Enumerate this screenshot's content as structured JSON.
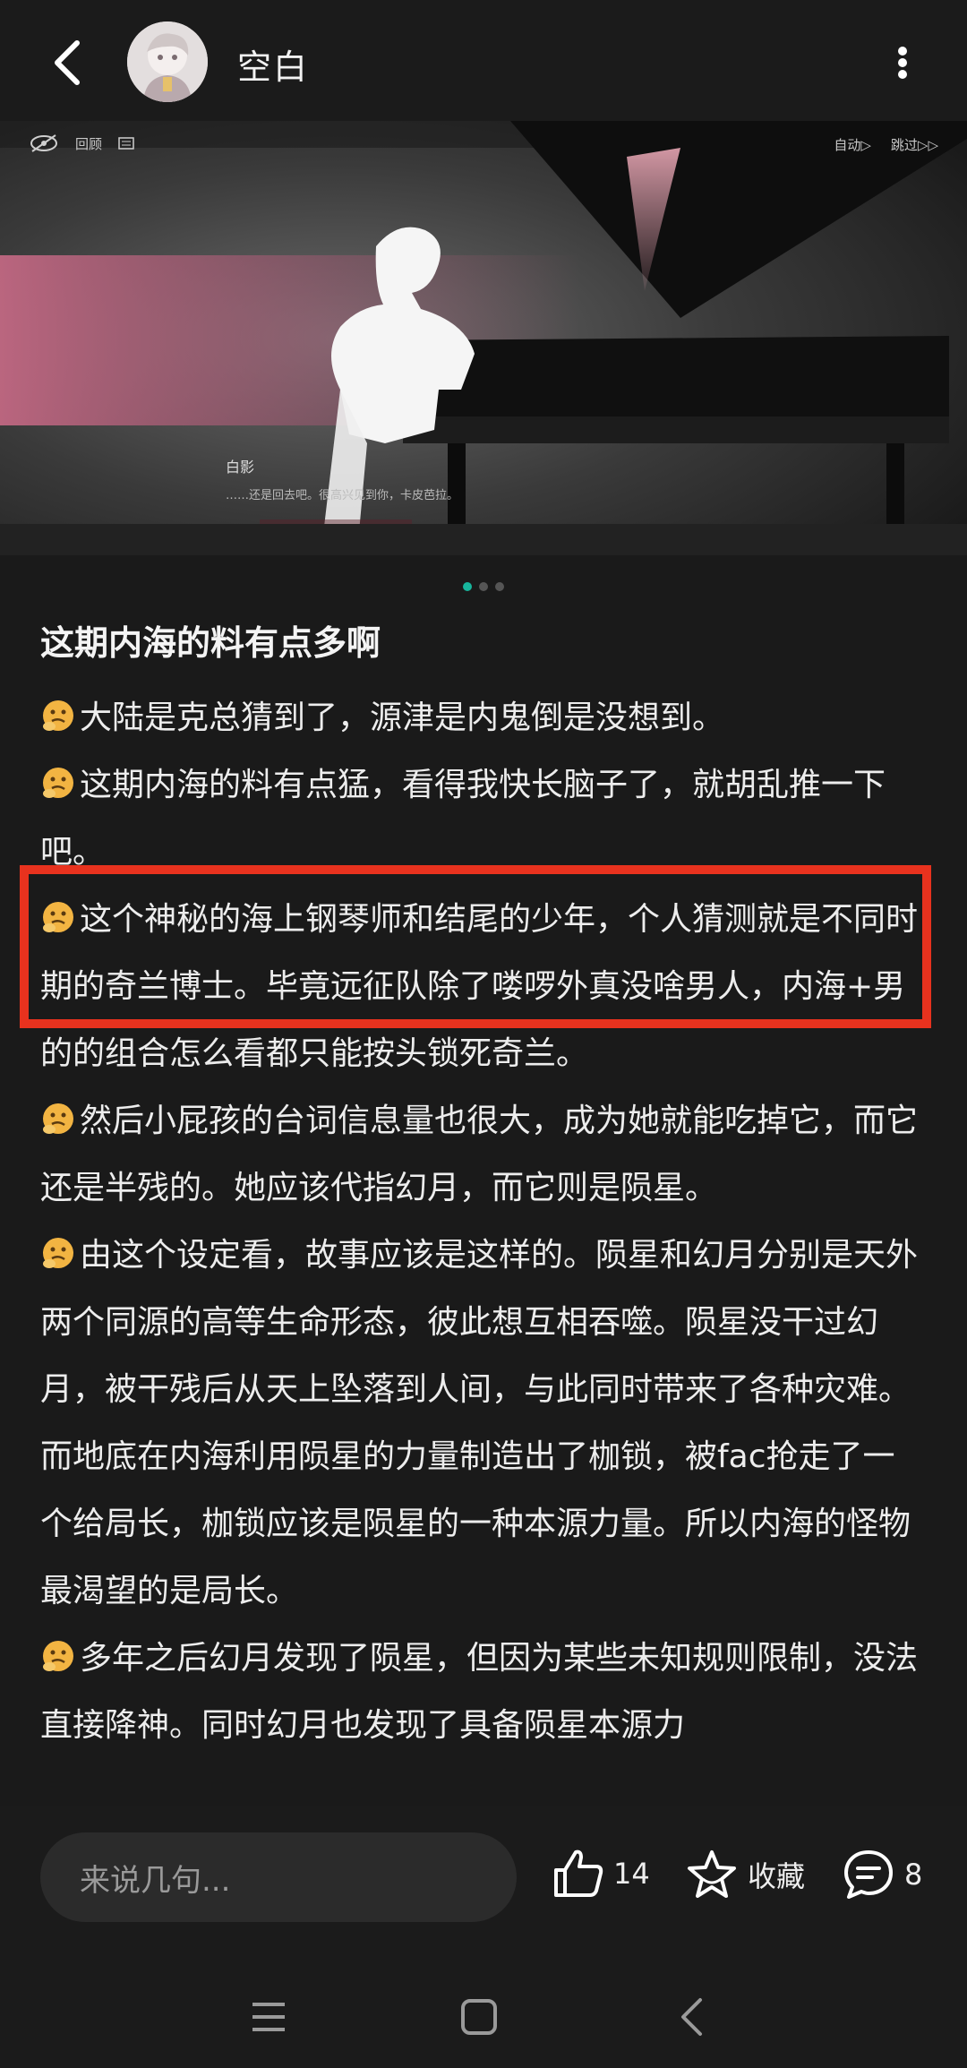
{
  "header": {
    "title": "空白",
    "icons": {
      "back": "chevron-left-icon",
      "more": "more-vertical-icon"
    }
  },
  "banner": {
    "top_left_label": "回顾",
    "top_right": [
      "自动▷",
      "跳过▷▷"
    ],
    "speaker": "白影",
    "caption": "……还是回去吧。很高兴见到你，卡皮芭拉。"
  },
  "carousel": {
    "count": 3,
    "active_index": 0,
    "accent_color": "#17b59c"
  },
  "post": {
    "title": "这期内海的料有点多啊",
    "paragraphs": [
      "大陆是克总猜到了，源津是内鬼倒是没想到。",
      "这期内海的料有点猛，看得我快长脑子了，就胡乱推一下吧。",
      "这个神秘的海上钢琴师和结尾的少年，个人猜测就是不同时期的奇兰博士。毕竟远征队除了喽啰外真没啥男人，内海+男的的组合怎么看都只能按头锁死奇兰。",
      "然后小屁孩的台词信息量也很大，成为她就能吃掉它，而它还是半残的。她应该代指幻月，而它则是陨星。",
      "由这个设定看，故事应该是这样的。陨星和幻月分别是天外两个同源的高等生命形态，彼此想互相吞噬。陨星没干过幻月，被干残后从天上坠落到人间，与此同时带来了各种灾难。而地底在内海利用陨星的力量制造出了枷锁，被fac抢走了一个给局长，枷锁应该是陨星的一种本源力量。所以内海的怪物最渴望的是局长。",
      "多年之后幻月发现了陨星，但因为某些未知规则限制，没法直接降神。同时幻月也发现了具备陨星本源力"
    ],
    "highlight_color": "#e8321e"
  },
  "bottom_bar": {
    "comment_placeholder": "来说几句...",
    "like_count": "14",
    "favorite_label": "收藏",
    "comment_count": "8"
  },
  "nav": {
    "icons": [
      "recent-apps-icon",
      "home-icon",
      "back-icon"
    ]
  }
}
